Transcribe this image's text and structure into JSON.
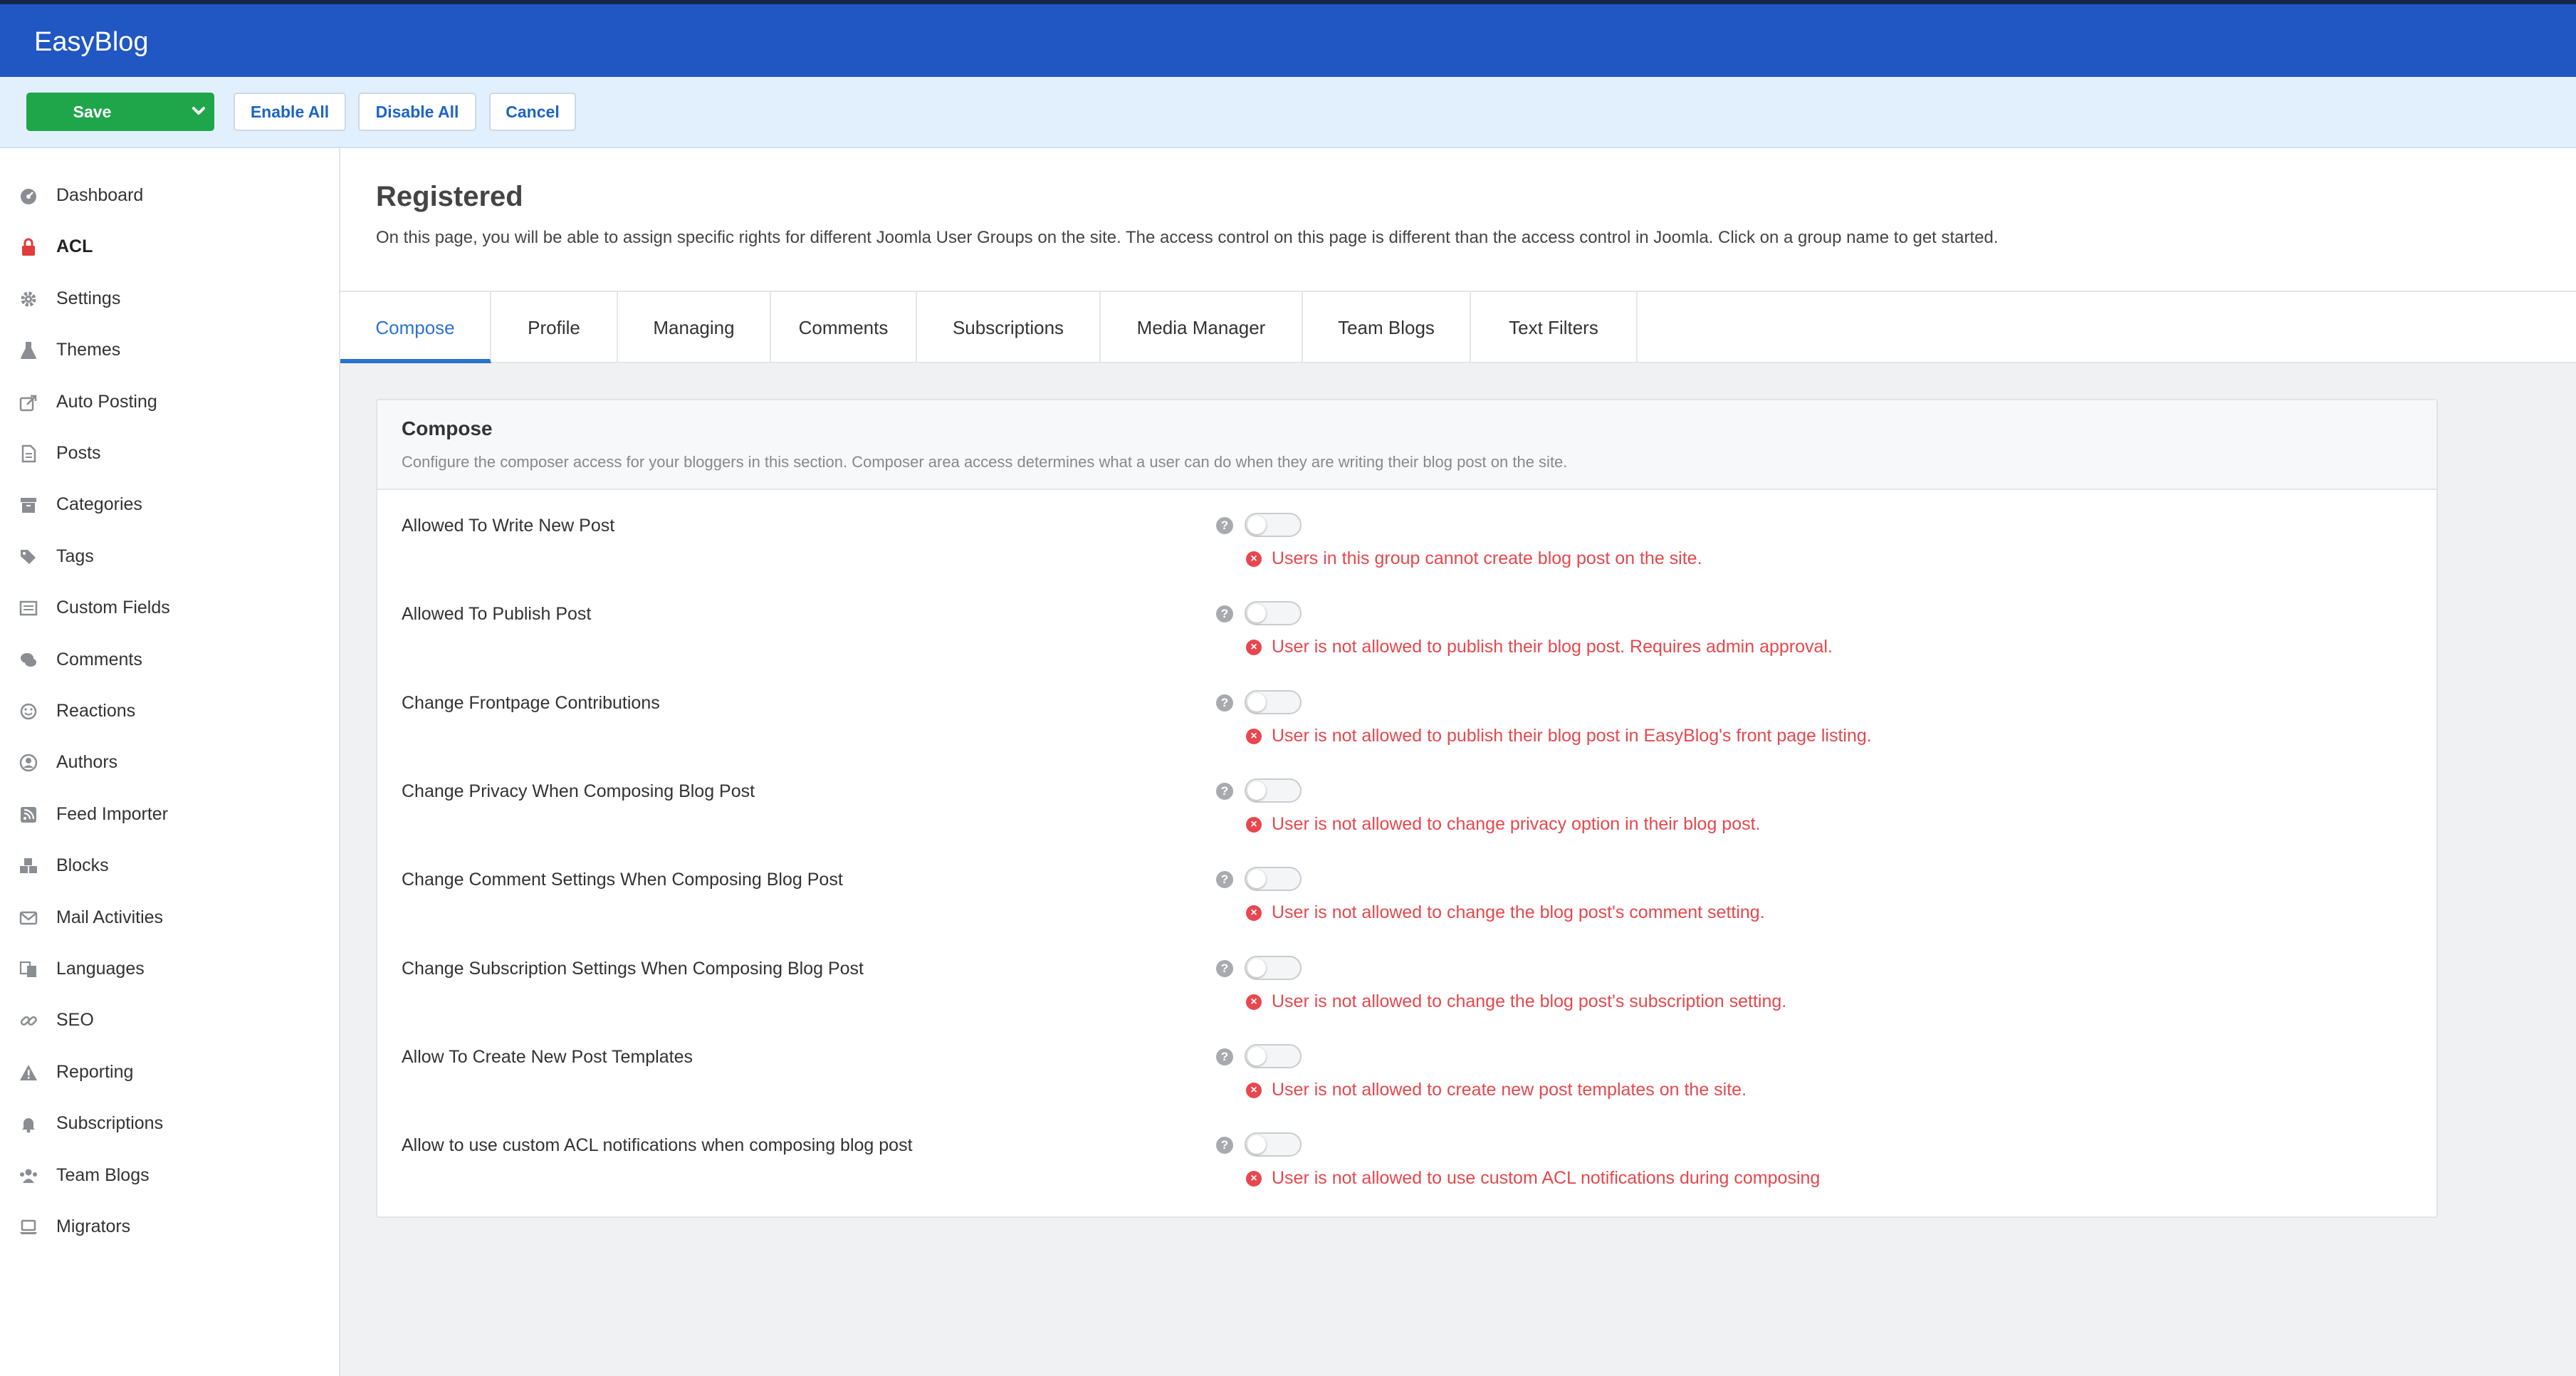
{
  "app": {
    "title": "EasyBlog"
  },
  "toolbar": {
    "save_label": "Save",
    "enable_all_label": "Enable All",
    "disable_all_label": "Disable All",
    "cancel_label": "Cancel"
  },
  "sidebar": {
    "active": "ACL",
    "items": [
      {
        "label": "Dashboard",
        "icon": "dashboard-icon"
      },
      {
        "label": "ACL",
        "icon": "lock-icon"
      },
      {
        "label": "Settings",
        "icon": "gear-icon"
      },
      {
        "label": "Themes",
        "icon": "flask-icon"
      },
      {
        "label": "Auto Posting",
        "icon": "share-icon"
      },
      {
        "label": "Posts",
        "icon": "document-icon"
      },
      {
        "label": "Categories",
        "icon": "archive-icon"
      },
      {
        "label": "Tags",
        "icon": "tags-icon"
      },
      {
        "label": "Custom Fields",
        "icon": "list-icon"
      },
      {
        "label": "Comments",
        "icon": "comments-icon"
      },
      {
        "label": "Reactions",
        "icon": "smile-icon"
      },
      {
        "label": "Authors",
        "icon": "user-circle-icon"
      },
      {
        "label": "Feed Importer",
        "icon": "rss-icon"
      },
      {
        "label": "Blocks",
        "icon": "cubes-icon"
      },
      {
        "label": "Mail Activities",
        "icon": "envelope-icon"
      },
      {
        "label": "Languages",
        "icon": "language-icon"
      },
      {
        "label": "SEO",
        "icon": "link-icon"
      },
      {
        "label": "Reporting",
        "icon": "warning-icon"
      },
      {
        "label": "Subscriptions",
        "icon": "bell-icon"
      },
      {
        "label": "Team Blogs",
        "icon": "users-icon"
      },
      {
        "label": "Migrators",
        "icon": "laptop-icon"
      }
    ]
  },
  "header": {
    "title": "Registered",
    "description": "On this page, you will be able to assign specific rights for different Joomla User Groups on the site. The access control on this page is different than the access control in Joomla. Click on a group name to get started."
  },
  "tabs": {
    "active": "Compose",
    "items": [
      "Compose",
      "Profile",
      "Managing",
      "Comments",
      "Subscriptions",
      "Media Manager",
      "Team Blogs",
      "Text Filters"
    ]
  },
  "panel": {
    "title": "Compose",
    "description": "Configure the composer access for your bloggers in this section. Composer area access determines what a user can do when they are writing their blog post on the site.",
    "help_glyph": "?",
    "error_glyph": "×",
    "rows": [
      {
        "label": "Allowed To Write New Post",
        "enabled": false,
        "message": "Users in this group cannot create blog post on the site."
      },
      {
        "label": "Allowed To Publish Post",
        "enabled": false,
        "message": "User is not allowed to publish their blog post. Requires admin approval."
      },
      {
        "label": "Change Frontpage Contributions",
        "enabled": false,
        "message": "User is not allowed to publish their blog post in EasyBlog's front page listing."
      },
      {
        "label": "Change Privacy When Composing Blog Post",
        "enabled": false,
        "message": "User is not allowed to change privacy option in their blog post."
      },
      {
        "label": "Change Comment Settings When Composing Blog Post",
        "enabled": false,
        "message": "User is not allowed to change the blog post's comment setting."
      },
      {
        "label": "Change Subscription Settings When Composing Blog Post",
        "enabled": false,
        "message": "User is not allowed to change the blog post's subscription setting."
      },
      {
        "label": "Allow To Create New Post Templates",
        "enabled": false,
        "message": "User is not allowed to create new post templates on the site."
      },
      {
        "label": "Allow to use custom ACL notifications when composing blog post",
        "enabled": false,
        "message": "User is not allowed to use custom ACL notifications during composing"
      }
    ]
  },
  "colors": {
    "brand_bar": "#2157c2",
    "save_green": "#1fa64b",
    "tab_active": "#2a73cc",
    "error_red": "#e5484d"
  }
}
